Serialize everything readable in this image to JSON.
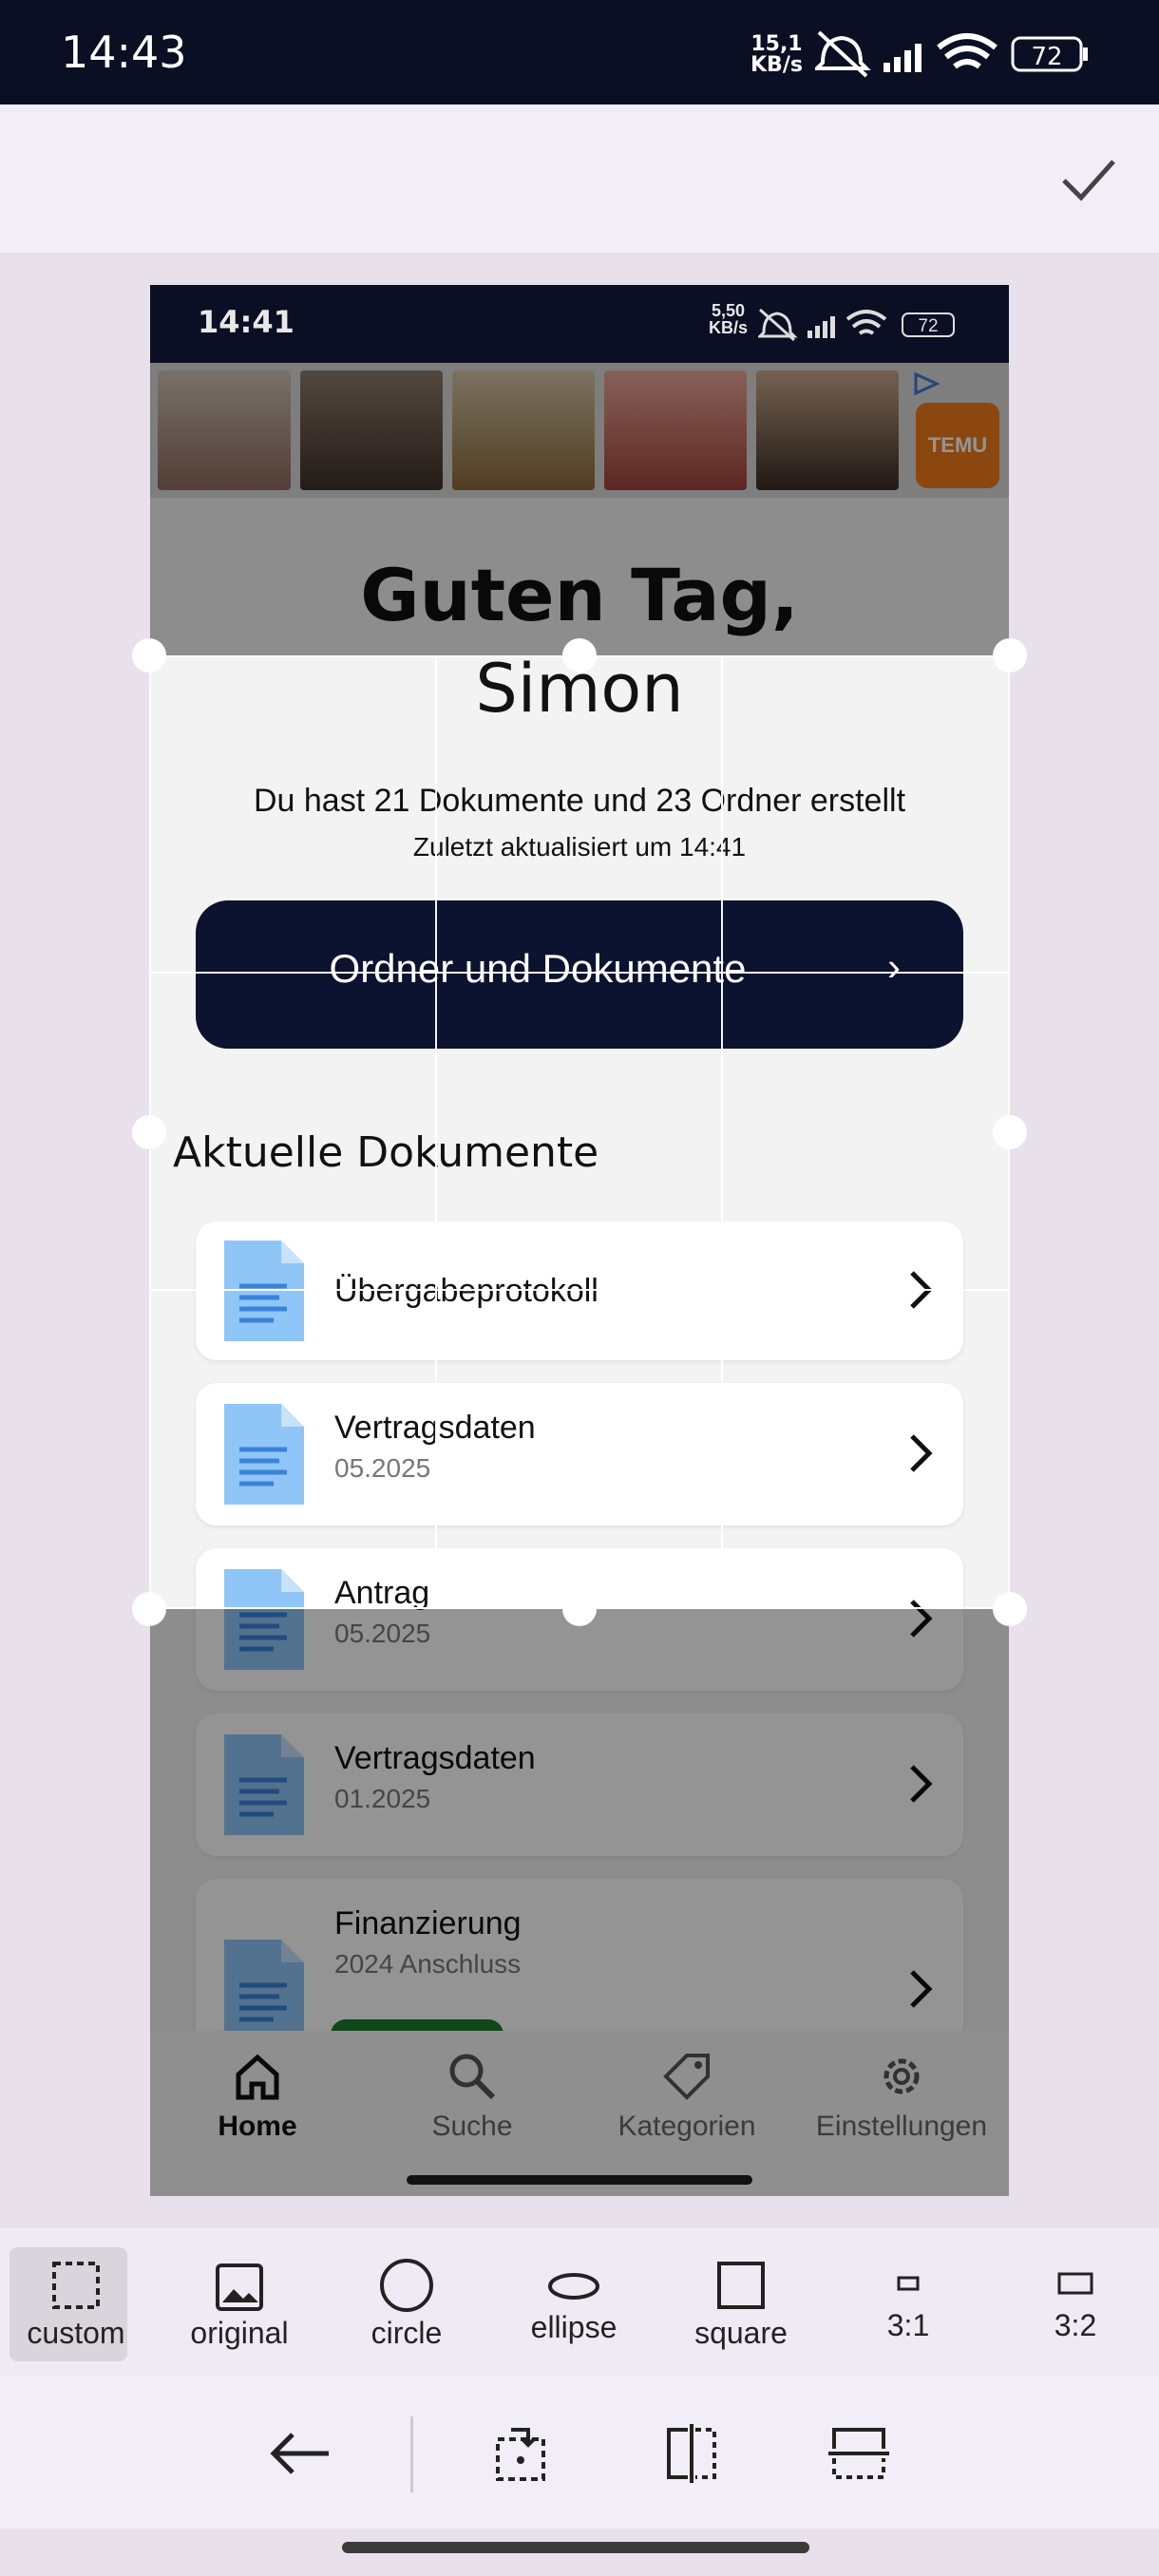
{
  "status_bar": {
    "time": "14:43",
    "net_speed_value": "15,1",
    "net_speed_unit": "KB/s",
    "battery": "72"
  },
  "top_bar": {
    "confirm_icon": "check-icon"
  },
  "screenshot": {
    "status": {
      "time": "14:41",
      "net_speed_value": "5,50",
      "net_speed_unit": "KB/s",
      "battery": "72"
    },
    "ad": {
      "brand": "TEMU"
    },
    "greeting_line1": "Guten Tag,",
    "greeting_line2": "Simon",
    "summary": "Du hast 21 Dokumente und 23 Ordner erstellt",
    "updated": "Zuletzt aktualisiert um 14:41",
    "folders_button": "Ordner und Dokumente",
    "section_title": "Aktuelle Dokumente",
    "documents": [
      {
        "title": "Übergabeprotokoll",
        "subtitle": ""
      },
      {
        "title": "Vertragsdaten",
        "subtitle": "05.2025"
      },
      {
        "title": "Antrag",
        "subtitle": "05.2025"
      },
      {
        "title": "Vertragsdaten",
        "subtitle": "01.2025"
      },
      {
        "title": "Finanzierung",
        "subtitle": "2024 Anschluss"
      }
    ],
    "nav": [
      {
        "label": "Home",
        "icon": "home-icon",
        "active": true
      },
      {
        "label": "Suche",
        "icon": "search-icon"
      },
      {
        "label": "Kategorien",
        "icon": "tag-icon"
      },
      {
        "label": "Einstellungen",
        "icon": "gear-icon"
      }
    ]
  },
  "shapes": [
    {
      "label": "custom",
      "icon": "dashed-square-icon",
      "selected": true
    },
    {
      "label": "original",
      "icon": "image-icon"
    },
    {
      "label": "circle",
      "icon": "circle-icon"
    },
    {
      "label": "ellipse",
      "icon": "ellipse-icon"
    },
    {
      "label": "square",
      "icon": "square-icon"
    },
    {
      "label": "3:1",
      "icon": "ratio-3-1-icon"
    },
    {
      "label": "3:2",
      "icon": "ratio-3-2-icon"
    }
  ],
  "actions": [
    {
      "name": "back",
      "icon": "arrow-left-icon"
    },
    {
      "name": "rotate",
      "icon": "rotate-icon"
    },
    {
      "name": "flip-horizontal",
      "icon": "flip-horizontal-icon"
    },
    {
      "name": "flip-vertical",
      "icon": "flip-vertical-icon"
    }
  ],
  "colors": {
    "status_bg": "#0b0f24",
    "button_bg": "#0b1330",
    "doc_icon": "#90c5f7",
    "accent_green": "#1a7a2a",
    "canvas_bg": "#e8e1ec"
  }
}
